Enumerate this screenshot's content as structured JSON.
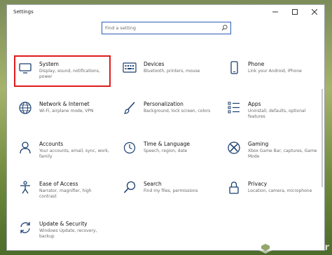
{
  "window": {
    "title": "Settings"
  },
  "search": {
    "placeholder": "Find a setting"
  },
  "tiles": [
    {
      "name": "System",
      "desc": "Display, sound, notifications, power",
      "icon": "monitor-icon"
    },
    {
      "name": "Devices",
      "desc": "Bluetooth, printers, mouse",
      "icon": "keyboard-icon"
    },
    {
      "name": "Phone",
      "desc": "Link your Android, iPhone",
      "icon": "phone-icon"
    },
    {
      "name": "Network & Internet",
      "desc": "Wi-Fi, airplane mode, VPN",
      "icon": "globe-icon"
    },
    {
      "name": "Personalization",
      "desc": "Background, lock screen, colors",
      "icon": "brush-icon"
    },
    {
      "name": "Apps",
      "desc": "Uninstall, defaults, optional features",
      "icon": "apps-list-icon"
    },
    {
      "name": "Accounts",
      "desc": "Your accounts, email, sync, work, family",
      "icon": "person-icon"
    },
    {
      "name": "Time & Language",
      "desc": "Speech, region, date",
      "icon": "time-language-icon"
    },
    {
      "name": "Gaming",
      "desc": "Xbox Game Bar, captures, Game Mode",
      "icon": "xbox-icon"
    },
    {
      "name": "Ease of Access",
      "desc": "Narrator, magnifier, high contrast",
      "icon": "accessibility-icon"
    },
    {
      "name": "Search",
      "desc": "Find my files, permissions",
      "icon": "search-icon"
    },
    {
      "name": "Privacy",
      "desc": "Location, camera, microphone",
      "icon": "lock-icon"
    },
    {
      "name": "Update & Security",
      "desc": "Windows Update, recovery, backup",
      "icon": "update-icon"
    }
  ],
  "watermark": {
    "text": "WinBuzzer"
  },
  "colors": {
    "accent": "#2a5db0",
    "highlight": "#e01b1b",
    "icon": "#1b3f6e"
  }
}
